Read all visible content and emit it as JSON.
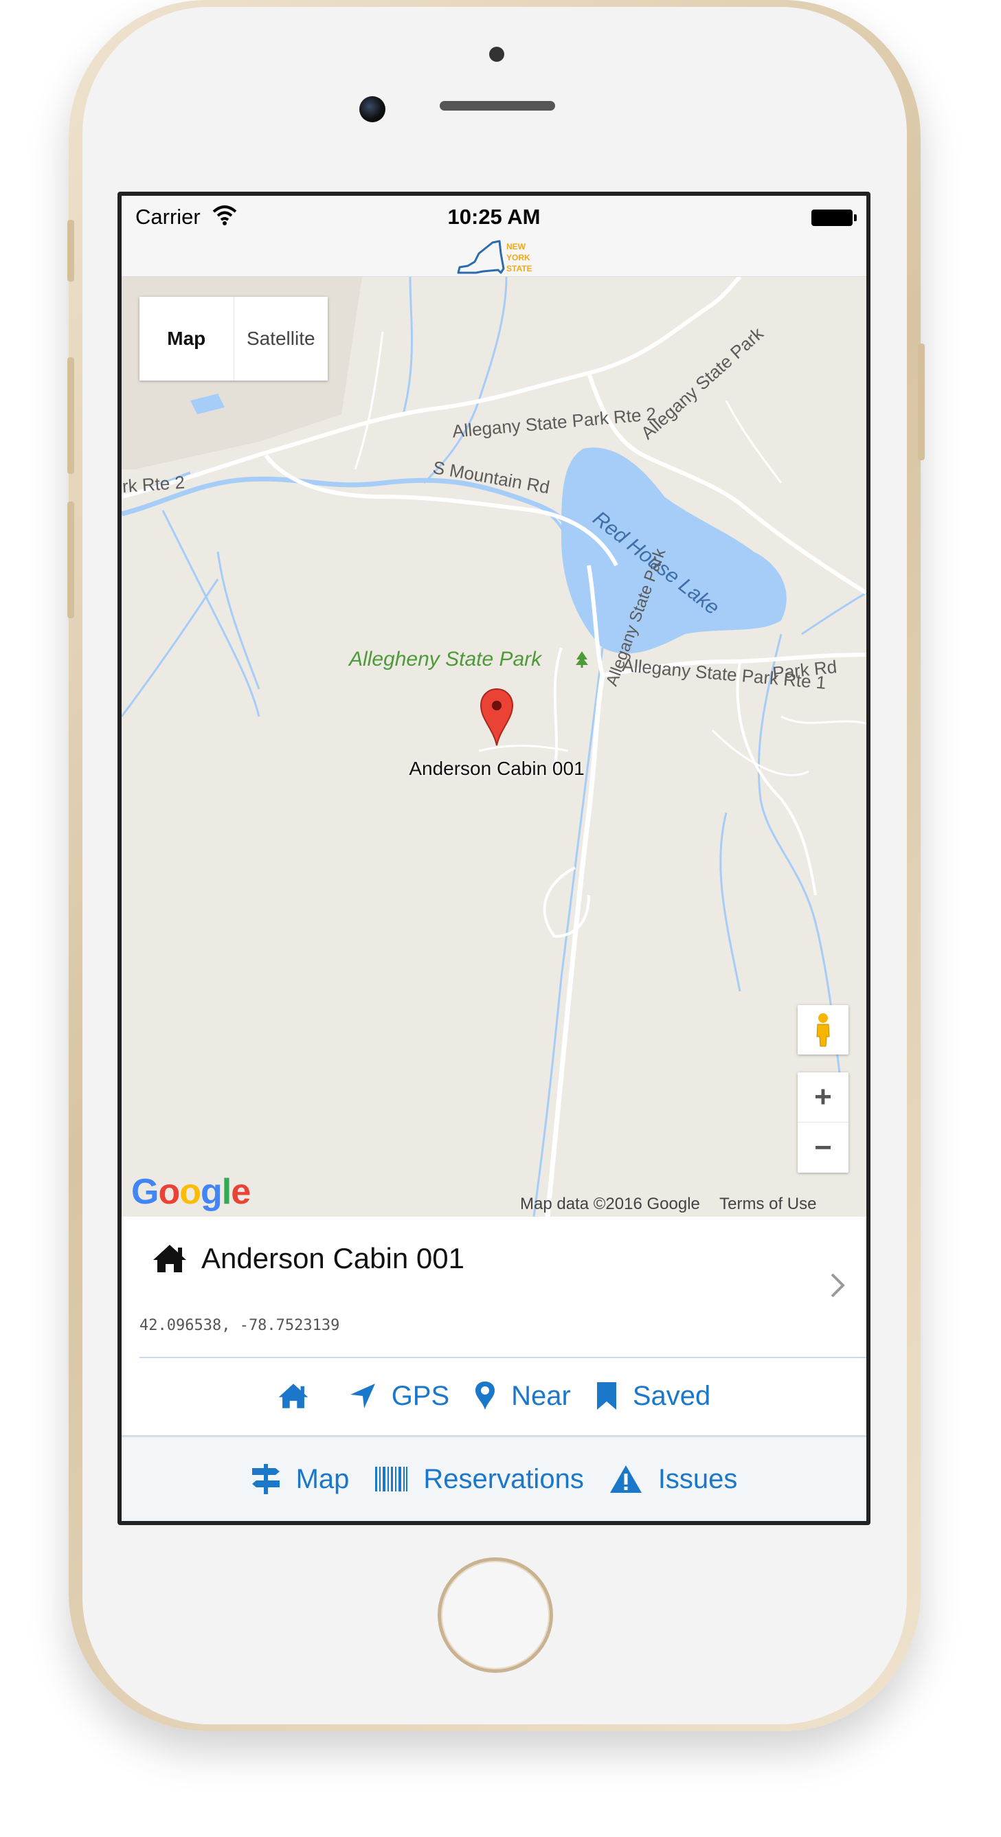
{
  "status_bar": {
    "carrier": "Carrier",
    "time": "10:25 AM"
  },
  "logo": {
    "line1": "NEW",
    "line2": "YORK",
    "line3": "STATE"
  },
  "map": {
    "type_control": {
      "map": "Map",
      "satellite": "Satellite"
    },
    "labels": {
      "rte2_top": "Allegany State Park Rte 2",
      "rte2_diag": "Allegany State Park",
      "rte2_left": "rk Rte 2",
      "s_mountain": "S Mountain Rd",
      "lake": "Red House Lake",
      "park": "Allegheny State Park",
      "rte1": "Allegany State Park Rte 1",
      "park_rd": "Park Rd",
      "vertical_road": "Allegany State Park"
    },
    "marker_label": "Anderson Cabin 001",
    "zoom_in": "+",
    "zoom_out": "−",
    "google_logo": "Google",
    "attribution": {
      "map_data": "Map data ©2016 Google",
      "terms": "Terms of Use"
    },
    "colors": {
      "land": "#ede9e3",
      "water": "#a6cdf8",
      "road": "#ffffff",
      "park": "#4e9a3a"
    }
  },
  "info_panel": {
    "title": "Anderson Cabin 001",
    "coordinates": "42.096538, -78.7523139",
    "icon": "home-icon"
  },
  "toolbar_primary": [
    {
      "icon": "home-icon",
      "label": ""
    },
    {
      "icon": "location-arrow-icon",
      "label": "GPS"
    },
    {
      "icon": "map-pin-icon",
      "label": "Near"
    },
    {
      "icon": "bookmark-icon",
      "label": "Saved"
    }
  ],
  "toolbar_secondary": [
    {
      "icon": "signpost-icon",
      "label": "Map"
    },
    {
      "icon": "barcode-icon",
      "label": "Reservations"
    },
    {
      "icon": "warning-icon",
      "label": "Issues"
    }
  ],
  "accent_color": "#1a77c9"
}
